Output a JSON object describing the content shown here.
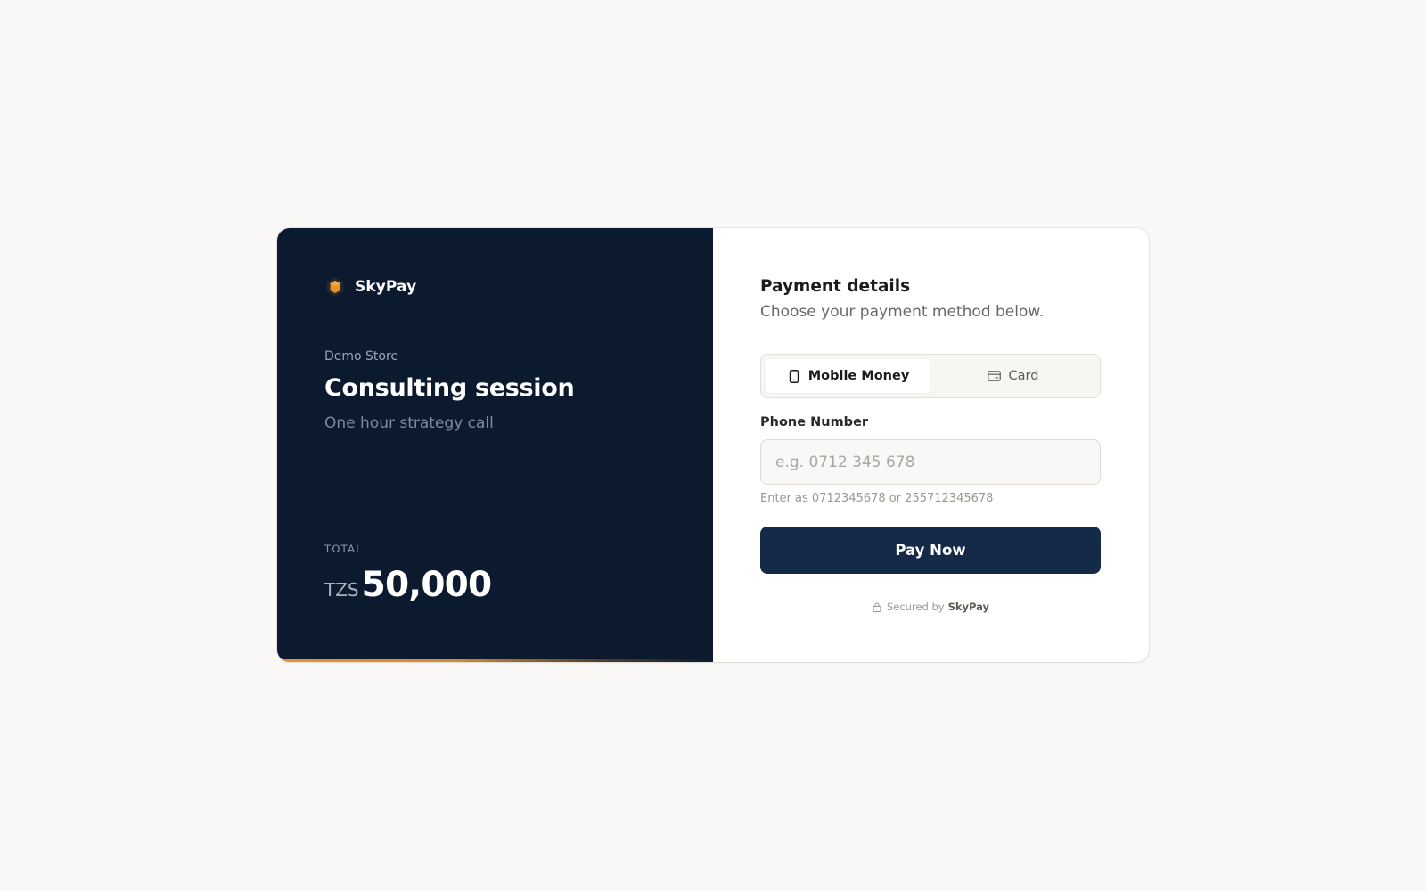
{
  "brand": {
    "name": "SkyPay",
    "accent_color": "#e8922c"
  },
  "order": {
    "store": "Demo Store",
    "product": "Consulting session",
    "description": "One hour strategy call",
    "total_label": "TOTAL",
    "currency": "TZS",
    "amount": "50,000"
  },
  "payment": {
    "title": "Payment details",
    "subtitle": "Choose your payment method below.",
    "tabs": [
      {
        "label": "Mobile Money",
        "icon": "phone-icon",
        "active": true
      },
      {
        "label": "Card",
        "icon": "credit-card-icon",
        "active": false
      }
    ],
    "phone_label": "Phone Number",
    "phone_placeholder": "e.g. 0712 345 678",
    "phone_value": "",
    "phone_hint": "Enter as 0712345678 or 255712345678",
    "pay_button": "Pay Now",
    "secured_text": "Secured by",
    "secured_brand": "SkyPay"
  },
  "colors": {
    "panel_dark": "#0c1a2f",
    "button": "#142a48",
    "page_bg": "#f9f8f6"
  }
}
